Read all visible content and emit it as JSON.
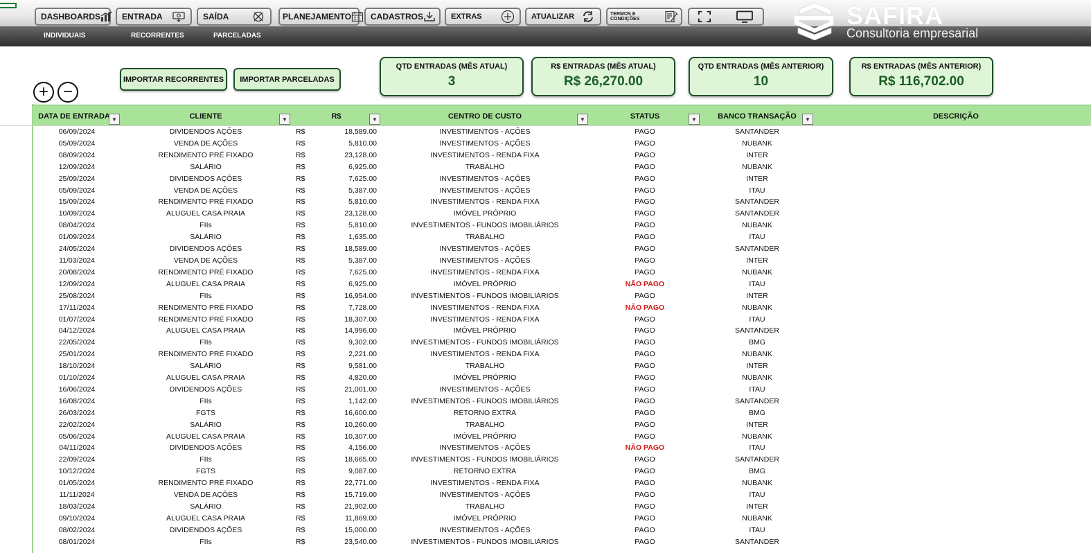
{
  "nav": {
    "buttons": [
      {
        "label": "DASHBOARDS",
        "icon": "chart-icon"
      },
      {
        "label": "ENTRADA",
        "icon": "money-in-icon"
      },
      {
        "label": "SAÍDA",
        "icon": "money-out-icon"
      },
      {
        "label": "PLANEJAMENTO",
        "icon": "calendar-icon"
      },
      {
        "label": "CADASTROS",
        "icon": "download-icon"
      },
      {
        "label": "EXTRAS",
        "icon": "plus-circle-icon"
      },
      {
        "label": "ATUALIZAR",
        "icon": "refresh-icon"
      },
      {
        "label": "TERMOS E CONDIÇÕES",
        "icon": "document-sign-icon"
      }
    ],
    "view_buttons": {
      "fullscreen_icon": "fullscreen-icon",
      "screen_icon": "monitor-icon"
    }
  },
  "brand": {
    "name": "SAFIRA",
    "subtitle": "Consultoria empresarial",
    "icon": "safira-logo-icon"
  },
  "subnav": {
    "items": [
      "INDIVIDUAIS",
      "RECORRENTES",
      "PARCELADAS"
    ]
  },
  "actions": {
    "add_icon": "+",
    "remove_icon": "−",
    "import_recurring": "IMPORTAR RECORRENTES",
    "import_installments": "IMPORTAR PARCELADAS"
  },
  "kpis": [
    {
      "title": "QTD ENTRADAS (MÊS ATUAL)",
      "value": "3"
    },
    {
      "title": "R$ ENTRADAS (MÊS ATUAL)",
      "value": "R$ 26,270.00"
    },
    {
      "title": "QTD ENTRADAS (MÊS ANTERIOR)",
      "value": "10"
    },
    {
      "title": "R$ ENTRADAS (MÊS ANTERIOR)",
      "value": "R$ 116,702.00"
    }
  ],
  "table": {
    "headers": {
      "date": "DATA DE ENTRADA",
      "client": "CLIENTE",
      "amount": "R$",
      "cost_center": "CENTRO DE CUSTO",
      "status": "STATUS",
      "bank": "BANCO TRANSAÇÃO",
      "description": "DESCRIÇÃO"
    },
    "filter_icon": "▼",
    "currency": "R$",
    "rows": [
      [
        "06/09/2024",
        "DIVIDENDOS AÇÕES",
        "18,589.00",
        "INVESTIMENTOS - AÇÕES",
        "PAGO",
        "SANTANDER"
      ],
      [
        "05/09/2024",
        "VENDA DE AÇÕES",
        "5,810.00",
        "INVESTIMENTOS - AÇÕES",
        "PAGO",
        "NUBANK"
      ],
      [
        "08/09/2024",
        "RENDIMENTO PRÉ FIXADO",
        "23,128.00",
        "INVESTIMENTOS - RENDA FIXA",
        "PAGO",
        "INTER"
      ],
      [
        "12/09/2024",
        "SALÁRIO",
        "6,925.00",
        "TRABALHO",
        "PAGO",
        "NUBANK"
      ],
      [
        "25/09/2024",
        "DIVIDENDOS AÇÕES",
        "7,625.00",
        "INVESTIMENTOS - AÇÕES",
        "PAGO",
        "INTER"
      ],
      [
        "05/09/2024",
        "VENDA DE AÇÕES",
        "5,387.00",
        "INVESTIMENTOS - AÇÕES",
        "PAGO",
        "ITAU"
      ],
      [
        "15/09/2024",
        "RENDIMENTO PRÉ FIXADO",
        "5,810.00",
        "INVESTIMENTOS - RENDA FIXA",
        "PAGO",
        "SANTANDER"
      ],
      [
        "10/09/2024",
        "ALUGUEL CASA PRAIA",
        "23,128.00",
        "IMÓVEL PRÓPRIO",
        "PAGO",
        "SANTANDER"
      ],
      [
        "08/04/2024",
        "FIIs",
        "5,810.00",
        "INVESTIMENTOS - FUNDOS IMOBILIÁRIOS",
        "PAGO",
        "NUBANK"
      ],
      [
        "01/09/2024",
        "SALÁRIO",
        "1,635.00",
        "TRABALHO",
        "PAGO",
        "ITAU"
      ],
      [
        "24/05/2024",
        "DIVIDENDOS AÇÕES",
        "18,589.00",
        "INVESTIMENTOS - AÇÕES",
        "PAGO",
        "SANTANDER"
      ],
      [
        "11/03/2024",
        "VENDA DE AÇÕES",
        "5,387.00",
        "INVESTIMENTOS - AÇÕES",
        "PAGO",
        "INTER"
      ],
      [
        "20/08/2024",
        "RENDIMENTO PRÉ FIXADO",
        "7,625.00",
        "INVESTIMENTOS - RENDA FIXA",
        "PAGO",
        "NUBANK"
      ],
      [
        "12/09/2024",
        "ALUGUEL CASA PRAIA",
        "6,925.00",
        "IMÓVEL PRÓPRIO",
        "NÃO PAGO",
        "ITAU"
      ],
      [
        "25/08/2024",
        "FIIs",
        "16,954.00",
        "INVESTIMENTOS - FUNDOS IMOBILIÁRIOS",
        "PAGO",
        "INTER"
      ],
      [
        "17/11/2024",
        "RENDIMENTO PRÉ FIXADO",
        "7,728.00",
        "INVESTIMENTOS - RENDA FIXA",
        "NÃO PAGO",
        "NUBANK"
      ],
      [
        "01/07/2024",
        "RENDIMENTO PRÉ FIXADO",
        "18,307.00",
        "INVESTIMENTOS - RENDA FIXA",
        "PAGO",
        "ITAU"
      ],
      [
        "04/12/2024",
        "ALUGUEL CASA PRAIA",
        "14,996.00",
        "IMÓVEL PRÓPRIO",
        "PAGO",
        "SANTANDER"
      ],
      [
        "22/05/2024",
        "FIIs",
        "9,302.00",
        "INVESTIMENTOS - FUNDOS IMOBILIÁRIOS",
        "PAGO",
        "BMG"
      ],
      [
        "25/01/2024",
        "RENDIMENTO PRÉ FIXADO",
        "2,221.00",
        "INVESTIMENTOS - RENDA FIXA",
        "PAGO",
        "NUBANK"
      ],
      [
        "18/10/2024",
        "SALÁRIO",
        "9,581.00",
        "TRABALHO",
        "PAGO",
        "INTER"
      ],
      [
        "01/10/2024",
        "ALUGUEL CASA PRAIA",
        "4,820.00",
        "IMÓVEL PRÓPRIO",
        "PAGO",
        "NUBANK"
      ],
      [
        "16/06/2024",
        "DIVIDENDOS AÇÕES",
        "21,001.00",
        "INVESTIMENTOS - AÇÕES",
        "PAGO",
        "ITAU"
      ],
      [
        "16/08/2024",
        "FIIs",
        "1,142.00",
        "INVESTIMENTOS - FUNDOS IMOBILIÁRIOS",
        "PAGO",
        "SANTANDER"
      ],
      [
        "26/03/2024",
        "FGTS",
        "16,600.00",
        "RETORNO EXTRA",
        "PAGO",
        "BMG"
      ],
      [
        "22/02/2024",
        "SALÁRIO",
        "10,260.00",
        "TRABALHO",
        "PAGO",
        "INTER"
      ],
      [
        "05/06/2024",
        "ALUGUEL CASA PRAIA",
        "10,307.00",
        "IMÓVEL PRÓPRIO",
        "PAGO",
        "NUBANK"
      ],
      [
        "04/11/2024",
        "DIVIDENDOS AÇÕES",
        "4,156.00",
        "INVESTIMENTOS - AÇÕES",
        "NÃO PAGO",
        "ITAU"
      ],
      [
        "22/09/2024",
        "FIIs",
        "18,665.00",
        "INVESTIMENTOS - FUNDOS IMOBILIÁRIOS",
        "PAGO",
        "SANTANDER"
      ],
      [
        "10/12/2024",
        "FGTS",
        "9,087.00",
        "RETORNO EXTRA",
        "PAGO",
        "BMG"
      ],
      [
        "01/05/2024",
        "RENDIMENTO PRÉ FIXADO",
        "22,771.00",
        "INVESTIMENTOS - RENDA FIXA",
        "PAGO",
        "NUBANK"
      ],
      [
        "11/11/2024",
        "VENDA DE AÇÕES",
        "15,719.00",
        "INVESTIMENTOS - AÇÕES",
        "PAGO",
        "ITAU"
      ],
      [
        "18/03/2024",
        "SALÁRIO",
        "21,902.00",
        "TRABALHO",
        "PAGO",
        "INTER"
      ],
      [
        "09/10/2024",
        "ALUGUEL CASA PRAIA",
        "11,869.00",
        "IMÓVEL PRÓPRIO",
        "PAGO",
        "NUBANK"
      ],
      [
        "08/02/2024",
        "DIVIDENDOS AÇÕES",
        "15,000.00",
        "INVESTIMENTOS - AÇÕES",
        "PAGO",
        "ITAU"
      ],
      [
        "08/01/2024",
        "FIIs",
        "23,540.00",
        "INVESTIMENTOS - FUNDOS IMOBILIÁRIOS",
        "PAGO",
        "SANTANDER"
      ]
    ]
  },
  "colors": {
    "accent_green": "#a9e39a",
    "kpi_value": "#1a5e25",
    "unpaid_red": "#d01818"
  }
}
